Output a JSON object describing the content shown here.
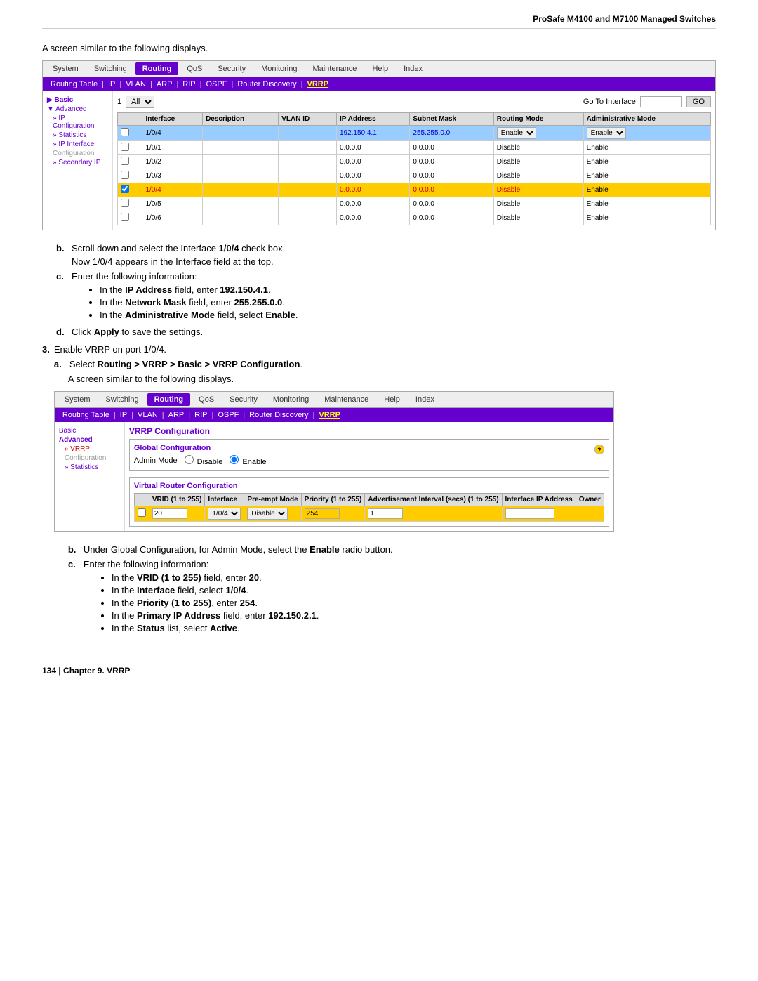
{
  "header": {
    "title": "ProSafe M4100 and M7100 Managed Switches"
  },
  "intro_text": "A screen similar to the following displays.",
  "panel1": {
    "nav": {
      "items": [
        "System",
        "Switching",
        "Routing",
        "QoS",
        "Security",
        "Monitoring",
        "Maintenance",
        "Help",
        "Index"
      ],
      "active": "Routing"
    },
    "subnav": {
      "items": [
        "Routing Table",
        "IP",
        "VLAN",
        "ARP",
        "RIP",
        "OSPF",
        "Router Discovery",
        "VRRP"
      ],
      "active": "VRRP"
    },
    "sidebar": {
      "items": [
        {
          "label": "Basic",
          "type": "header",
          "active": true
        },
        {
          "label": "Advanced",
          "type": "header"
        },
        {
          "label": "» IP Configuration",
          "type": "sub"
        },
        {
          "label": "» Statistics",
          "type": "sub"
        },
        {
          "label": "» IP Interface",
          "type": "sub"
        },
        {
          "label": "Configuration",
          "type": "sub"
        },
        {
          "label": "» Secondary IP",
          "type": "sub"
        }
      ]
    },
    "interface_row": {
      "label": "1",
      "all_label": "All",
      "go_to_label": "Go To Interface",
      "go_btn": "GO",
      "input_placeholder": ""
    },
    "table": {
      "headers": [
        "",
        "Interface",
        "Description",
        "VLAN ID",
        "IP Address",
        "Subnet Mask",
        "Routing Mode",
        "Administrative Mode"
      ],
      "rows": [
        {
          "checkbox": false,
          "interface": "1/0/4",
          "description": "",
          "vlan_id": "",
          "ip_address": "192.150.4.1",
          "subnet_mask": "255.255.0.0",
          "routing_mode": "Enable",
          "admin_mode": "Enable",
          "highlight": "blue"
        },
        {
          "checkbox": false,
          "interface": "1/0/1",
          "description": "",
          "vlan_id": "",
          "ip_address": "0.0.0.0",
          "subnet_mask": "0.0.0.0",
          "routing_mode": "Disable",
          "admin_mode": "Enable",
          "highlight": ""
        },
        {
          "checkbox": false,
          "interface": "1/0/2",
          "description": "",
          "vlan_id": "",
          "ip_address": "0.0.0.0",
          "subnet_mask": "0.0.0.0",
          "routing_mode": "Disable",
          "admin_mode": "Enable",
          "highlight": ""
        },
        {
          "checkbox": false,
          "interface": "1/0/3",
          "description": "",
          "vlan_id": "",
          "ip_address": "0.0.0.0",
          "subnet_mask": "0.0.0.0",
          "routing_mode": "Disable",
          "admin_mode": "Enable",
          "highlight": ""
        },
        {
          "checkbox": true,
          "interface": "1/0/4",
          "description": "",
          "vlan_id": "",
          "ip_address": "0.0.0.0",
          "subnet_mask": "0.0.0.0",
          "routing_mode": "Disable",
          "admin_mode": "Enable",
          "highlight": "orange"
        },
        {
          "checkbox": false,
          "interface": "1/0/5",
          "description": "",
          "vlan_id": "",
          "ip_address": "0.0.0.0",
          "subnet_mask": "0.0.0.0",
          "routing_mode": "Disable",
          "admin_mode": "Enable",
          "highlight": ""
        },
        {
          "checkbox": false,
          "interface": "1/0/6",
          "description": "",
          "vlan_id": "",
          "ip_address": "0.0.0.0",
          "subnet_mask": "0.0.0.0",
          "routing_mode": "Disable",
          "admin_mode": "Enable",
          "highlight": ""
        }
      ]
    }
  },
  "step_b_text": "Scroll down and select the Interface ",
  "step_b_bold": "1/0/4",
  "step_b_end": " check box.",
  "step_b_sub": "Now 1/0/4 appears in the Interface field at the top.",
  "step_c_text": "Enter the following information:",
  "step_c_bullets": [
    {
      "prefix": "In the ",
      "bold": "IP Address",
      "middle": " field, enter ",
      "value": "192.150.4.1",
      "suffix": "."
    },
    {
      "prefix": "In the ",
      "bold": "Network Mask",
      "middle": " field, enter ",
      "value": "255.255.0.0",
      "suffix": "."
    },
    {
      "prefix": "In the ",
      "bold": "Administrative Mode",
      "middle": " field, select ",
      "value": "Enable",
      "suffix": "."
    }
  ],
  "step_d_text": "Click ",
  "step_d_bold": "Apply",
  "step_d_end": " to save the settings.",
  "step3_text": "Enable VRRP on port 1/0/4.",
  "step3a_text": "Select ",
  "step3a_bold": "Routing > VRRP > Basic > VRRP Configuration",
  "step3a_end": ".",
  "intro_text2": "A screen similar to the following displays.",
  "panel2": {
    "nav": {
      "items": [
        "System",
        "Switching",
        "Routing",
        "QoS",
        "Security",
        "Monitoring",
        "Maintenance",
        "Help",
        "Index"
      ],
      "active": "Routing"
    },
    "subnav": {
      "items": [
        "Routing Table",
        "IP",
        "VLAN",
        "ARP",
        "RIP",
        "OSPF",
        "Router Discovery",
        "VRRP"
      ],
      "active": "VRRP"
    },
    "sidebar": {
      "items": [
        {
          "label": "Basic",
          "type": "header"
        },
        {
          "label": "Advanced",
          "type": "header",
          "active": true
        },
        {
          "label": "» VRRP",
          "type": "sub",
          "active": true
        },
        {
          "label": "Configuration",
          "type": "sub"
        },
        {
          "label": "» Statistics",
          "type": "sub"
        }
      ]
    },
    "vrrp_config": {
      "title": "VRRP Configuration",
      "global_config": {
        "title": "Global Configuration",
        "admin_mode_label": "Admin Mode",
        "disable_label": "Disable",
        "enable_label": "Enable",
        "selected": "enable"
      },
      "virtual_router": {
        "title": "Virtual Router Configuration",
        "headers": [
          "VRID (1 to 255)",
          "Interface",
          "Pre-empt Mode",
          "Priority (1 to 255)",
          "Advertisement Interval (secs) (1 to 255)",
          "Interface IP Address",
          "Owner"
        ],
        "row": {
          "checkbox": false,
          "vrid": "20",
          "interface": "1/0/4",
          "preempt": "Disable",
          "priority": "254",
          "adv_interval": "1",
          "ip_address": "",
          "owner": ""
        }
      }
    }
  },
  "step_b2_text": "Under Global Configuration, for Admin Mode, select the ",
  "step_b2_bold": "Enable",
  "step_b2_end": " radio button.",
  "step_c2_text": "Enter the following information:",
  "step_c2_bullets": [
    {
      "prefix": "In the ",
      "bold": "VRID (1 to 255)",
      "middle": " field, enter ",
      "value": "20",
      "suffix": "."
    },
    {
      "prefix": "In the ",
      "bold": "Interface",
      "middle": " field, select ",
      "value": "1/0/4",
      "suffix": "."
    },
    {
      "prefix": "In the ",
      "bold": "Priority (1 to 255)",
      "middle": ", enter ",
      "value": "254",
      "suffix": "."
    },
    {
      "prefix": "In the ",
      "bold": "Primary IP Address",
      "middle": " field, enter ",
      "value": "192.150.2.1",
      "suffix": "."
    },
    {
      "prefix": "In the ",
      "bold": "Status",
      "middle": " list, select ",
      "value": "Active",
      "suffix": "."
    }
  ],
  "footer": {
    "left": "134  |  Chapter 9.  VRRP"
  }
}
